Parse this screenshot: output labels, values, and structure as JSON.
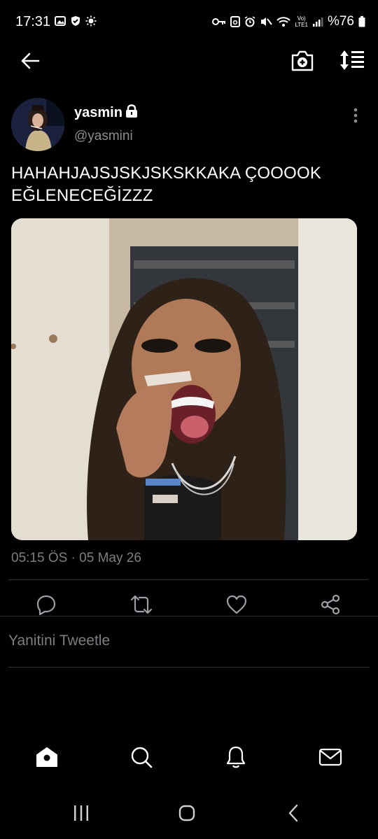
{
  "status_bar": {
    "time": "17:31",
    "battery_text": "%76",
    "network_label": "LTE1",
    "network_top": "Vo)"
  },
  "top_bar": {
    "back_icon": "arrow-left-icon",
    "camera_icon": "camera-plus-icon",
    "sort_icon": "sort-icon"
  },
  "tweet": {
    "display_name": "yasmin",
    "handle": "@yasmini",
    "text": "HAHAHJAJSJSKJSKSKKAKA ÇOOOOK EĞLENECEĞİZZZ",
    "timestamp": "05:15 ÖS · 05 May 26"
  },
  "actions": [
    "reply-icon",
    "retweet-icon",
    "like-icon",
    "share-icon"
  ],
  "reply": {
    "placeholder": "Yanitini Tweetle"
  },
  "bottom_nav": [
    "home-icon",
    "search-icon",
    "notifications-icon",
    "messages-icon"
  ],
  "system_nav": [
    "recents-icon",
    "home-circle-icon",
    "back-chevron-icon"
  ],
  "colors": {
    "background": "#000000",
    "secondary_text": "#7b7f84",
    "divider": "#2b2f33"
  }
}
